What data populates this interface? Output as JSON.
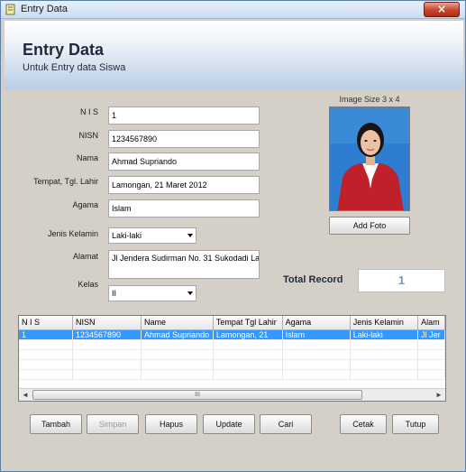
{
  "window": {
    "title": "Entry Data",
    "close": "×"
  },
  "header": {
    "title": "Entry Data",
    "subtitle": "Untuk Entry data Siswa"
  },
  "form": {
    "nis": {
      "label": "N I S",
      "value": "1"
    },
    "nisn": {
      "label": "NISN",
      "value": "1234567890"
    },
    "nama": {
      "label": "Nama",
      "value": "Ahmad Supriando"
    },
    "ttl": {
      "label": "Tempat, Tgl. Lahir",
      "value": "Lamongan, 21 Maret 2012"
    },
    "agama": {
      "label": "Agama",
      "value": "Islam"
    },
    "jenis_kelamin": {
      "label": "Jenis Kelamin",
      "value": "Laki-laki"
    },
    "alamat": {
      "label": "Alamat",
      "value": "Jl Jendera Sudirman  No. 31 Sukodadi La"
    },
    "kelas": {
      "label": "Kelas",
      "value": "II"
    }
  },
  "photo": {
    "caption": "Image Size 3 x 4",
    "add_button": "Add Foto"
  },
  "total": {
    "label": "Total Record",
    "value": "1"
  },
  "grid": {
    "columns": [
      "N I S",
      "NISN",
      "Name",
      "Tempat Tgl Lahir",
      "Agama",
      "Jenis Kelamin",
      "Alam"
    ],
    "rows": [
      [
        "1",
        "1234567890",
        "Ahmad Supriando",
        "Lamongan, 21",
        "Islam",
        "Laki-laki",
        "Jl Jer"
      ]
    ],
    "scroll_grip": "III"
  },
  "buttons": {
    "tambah": "Tambah",
    "simpan": "Simpan",
    "hapus": "Hapus",
    "update": "Update",
    "cari": "Cari",
    "cetak": "Cetak",
    "tutup": "Tutup"
  }
}
